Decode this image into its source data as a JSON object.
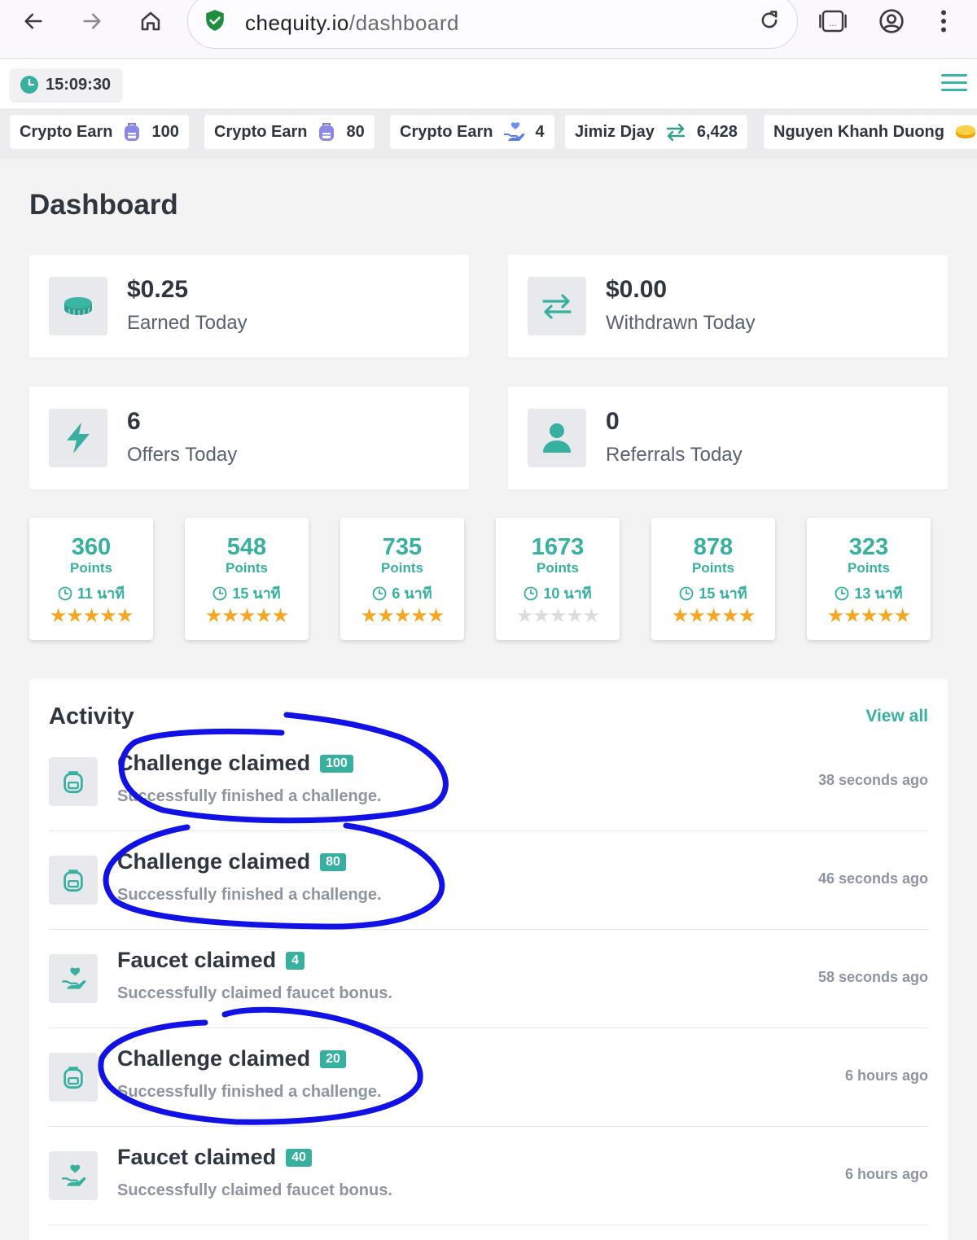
{
  "browser": {
    "url_domain": "chequity.io",
    "url_path": "/dashboard"
  },
  "topbar": {
    "clock": "15:09:30"
  },
  "ticker": [
    {
      "name": "Crypto Earn",
      "icon": "backpack-icon",
      "value": "100"
    },
    {
      "name": "Crypto Earn",
      "icon": "backpack-icon",
      "value": "80"
    },
    {
      "name": "Crypto Earn",
      "icon": "hand-heart-icon",
      "value": "4"
    },
    {
      "name": "Jimiz Djay",
      "icon": "exchange-icon",
      "value": "6,428"
    },
    {
      "name": "Nguyen Khanh Duong",
      "icon": "coins-icon",
      "value": ""
    }
  ],
  "page": {
    "title": "Dashboard"
  },
  "stats": [
    {
      "value": "$0.25",
      "label": "Earned Today",
      "icon": "coins-icon"
    },
    {
      "value": "$0.00",
      "label": "Withdrawn Today",
      "icon": "exchange-icon"
    },
    {
      "value": "6",
      "label": "Offers Today",
      "icon": "bolt-icon"
    },
    {
      "value": "0",
      "label": "Referrals Today",
      "icon": "user-icon"
    }
  ],
  "offers": [
    {
      "points": "360",
      "unit": "Points",
      "time": "11 นาที",
      "rating": 5
    },
    {
      "points": "548",
      "unit": "Points",
      "time": "15 นาที",
      "rating": 5
    },
    {
      "points": "735",
      "unit": "Points",
      "time": "6 นาที",
      "rating": 5
    },
    {
      "points": "1673",
      "unit": "Points",
      "time": "10 นาที",
      "rating": 0
    },
    {
      "points": "878",
      "unit": "Points",
      "time": "15 นาที",
      "rating": 5
    },
    {
      "points": "323",
      "unit": "Points",
      "time": "13 นาที",
      "rating": 5
    }
  ],
  "activity": {
    "title": "Activity",
    "view_all": "View all",
    "items": [
      {
        "title": "Challenge claimed",
        "badge": "100",
        "desc": "Successfully finished a challenge.",
        "time": "38 seconds ago",
        "icon": "backpack-icon"
      },
      {
        "title": "Challenge claimed",
        "badge": "80",
        "desc": "Successfully finished a challenge.",
        "time": "46 seconds ago",
        "icon": "backpack-icon"
      },
      {
        "title": "Faucet claimed",
        "badge": "4",
        "desc": "Successfully claimed faucet bonus.",
        "time": "58 seconds ago",
        "icon": "hand-heart-icon"
      },
      {
        "title": "Challenge claimed",
        "badge": "20",
        "desc": "Successfully finished a challenge.",
        "time": "6 hours ago",
        "icon": "backpack-icon"
      },
      {
        "title": "Faucet claimed",
        "badge": "40",
        "desc": "Successfully claimed faucet bonus.",
        "time": "6 hours ago",
        "icon": "hand-heart-icon"
      }
    ]
  },
  "colors": {
    "accent": "#37b0a0",
    "star": "#f5a623",
    "annotation": "#1010e0"
  }
}
